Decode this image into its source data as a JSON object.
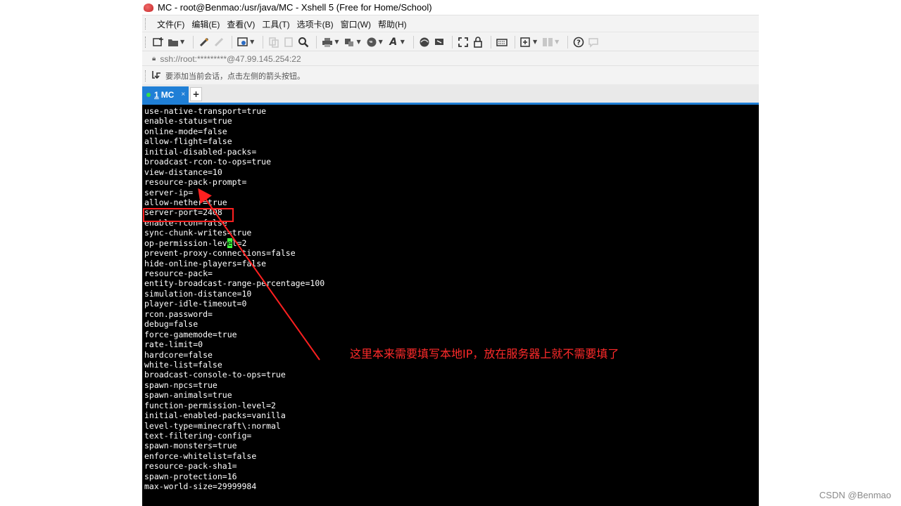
{
  "window": {
    "title": "MC - root@Benmao:/usr/java/MC - Xshell 5 (Free for Home/School)"
  },
  "menubar": {
    "items": [
      "文件(F)",
      "编辑(E)",
      "查看(V)",
      "工具(T)",
      "选项卡(B)",
      "窗口(W)",
      "帮助(H)"
    ]
  },
  "toolbar": {
    "icons": [
      "new-session-icon",
      "open-folder-icon",
      "reconnect-icon",
      "disconnect-icon",
      "properties-icon",
      "copy-icon",
      "paste-icon",
      "find-icon",
      "print-icon",
      "transfer-icon",
      "globe-icon",
      "font-icon",
      "xftp-icon",
      "xagent-icon",
      "fullscreen-icon",
      "lock-icon",
      "keyboard-icon",
      "add-tab-icon",
      "layout-icon",
      "help-icon",
      "chat-icon"
    ]
  },
  "address": {
    "value": "ssh://root:*********@47.99.145.254:22"
  },
  "hint": {
    "text": "要添加当前会话，点击左侧的箭头按钮。"
  },
  "tabs": [
    {
      "number": "1",
      "label": "MC",
      "close": "×"
    }
  ],
  "tab_add": "+",
  "terminal": {
    "lines": [
      "use-native-transport=true",
      "enable-status=true",
      "online-mode=false",
      "allow-flight=false",
      "initial-disabled-packs=",
      "broadcast-rcon-to-ops=true",
      "view-distance=10",
      "resource-pack-prompt=",
      "server-ip=",
      "allow-nether=true",
      "server-port=2408",
      "enable-rcon=false",
      "sync-chunk-writes=true",
      "op-permission-level=2",
      "prevent-proxy-connections=false",
      "hide-online-players=false",
      "resource-pack=",
      "entity-broadcast-range-percentage=100",
      "simulation-distance=10",
      "player-idle-timeout=0",
      "rcon.password=",
      "debug=false",
      "force-gamemode=true",
      "rate-limit=0",
      "hardcore=false",
      "white-list=false",
      "broadcast-console-to-ops=true",
      "spawn-npcs=true",
      "spawn-animals=true",
      "function-permission-level=2",
      "initial-enabled-packs=vanilla",
      "level-type=minecraft\\:normal",
      "text-filtering-config=",
      "spawn-monsters=true",
      "enforce-whitelist=false",
      "resource-pack-sha1=",
      "spawn-protection=16",
      "max-world-size=29999984"
    ],
    "cursor_line": 13,
    "cursor_col": 17
  },
  "annotation": {
    "text": "这里本来需要填写本地IP，放在服务器上就不需要填了",
    "color": "#ff2a2a"
  },
  "watermark": "CSDN @Benmao⁠"
}
